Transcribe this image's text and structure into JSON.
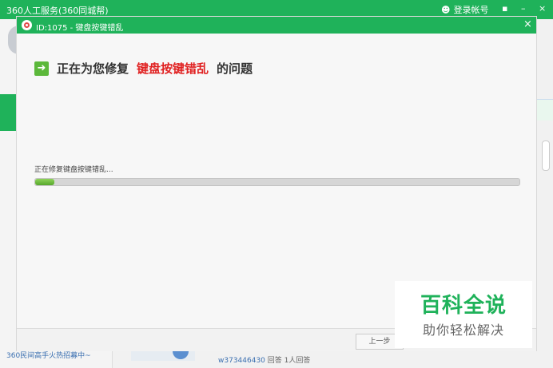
{
  "background": {
    "title": "360人工服务(360同城帮)",
    "login_label": "登录帐号",
    "ctrl_chat": "▪",
    "ctrl_minimize": "–",
    "ctrl_close": "×",
    "bottom_link": "360民间高手火热招募中~",
    "bottom_user": "w373446430",
    "bottom_meta": "回答   1人回答"
  },
  "dialog": {
    "title": "ID:1075 - 键盘按键错乱",
    "close_label": "×",
    "heading_prefix": "正在为您修复",
    "heading_issue": "键盘按键错乱",
    "heading_suffix": "的问题",
    "status_text": "正在修复键盘按键错乱...",
    "progress_percent": 4,
    "prev_button": "上一步"
  },
  "watermark": {
    "title": "百科全说",
    "subtitle": "助你轻松解决"
  },
  "colors": {
    "brand_green": "#1fb25a",
    "issue_red": "#e02020",
    "progress_green": "#56a72c"
  }
}
